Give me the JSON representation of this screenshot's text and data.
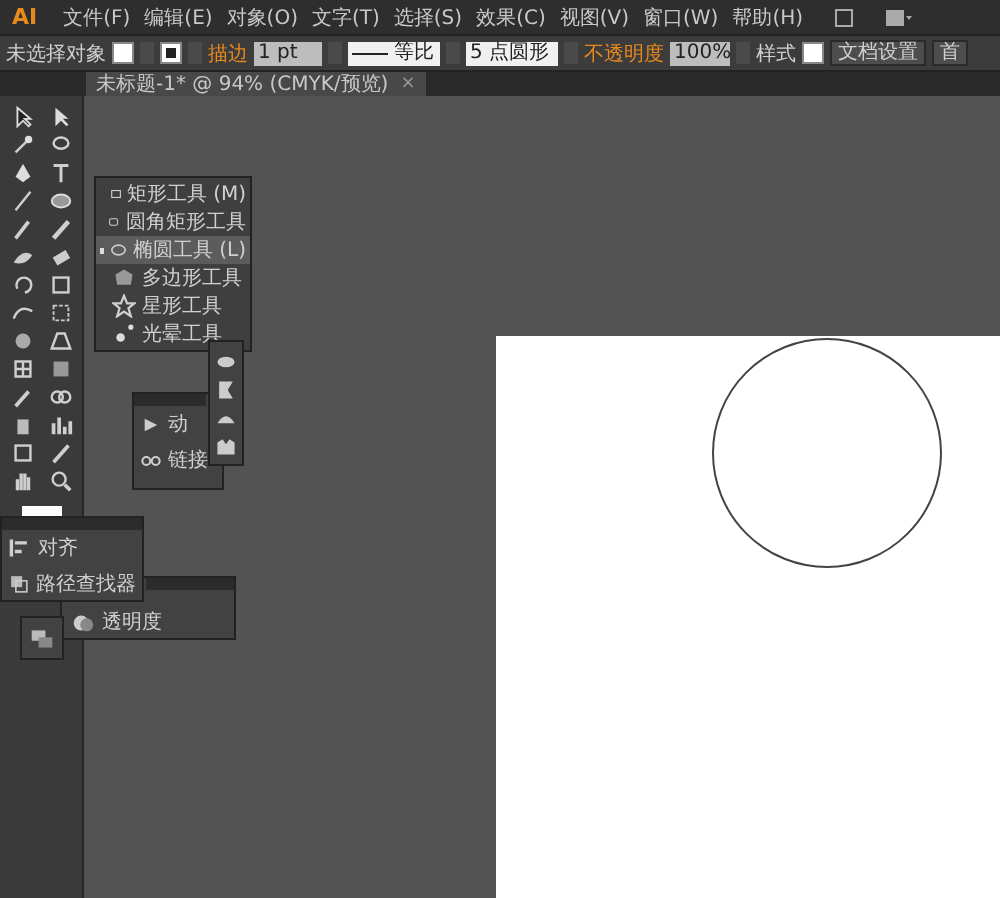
{
  "menu_bar": {
    "logo": "AI",
    "items": [
      "文件(F)",
      "编辑(E)",
      "对象(O)",
      "文字(T)",
      "选择(S)",
      "效果(C)",
      "视图(V)",
      "窗口(W)",
      "帮助(H)"
    ]
  },
  "control_bar": {
    "selection": "未选择对象",
    "stroke_label": "描边",
    "stroke_weight": "1 pt",
    "stroke_profile": "等比",
    "brush": "5 点圆形",
    "opacity_label": "不透明度",
    "opacity": "100%",
    "style_label": "样式",
    "buttons": [
      "文档设置",
      "首"
    ]
  },
  "document_tab": {
    "title": "未标题-1* @ 94% (CMYK/预览)",
    "close": "×"
  },
  "tool_flyout": {
    "items": [
      {
        "kind": "rect",
        "label": "矩形工具",
        "shortcut": "(M)",
        "selected": false
      },
      {
        "kind": "rounded",
        "label": "圆角矩形工具",
        "selected": false
      },
      {
        "kind": "ellipse",
        "label": "椭圆工具",
        "shortcut": "(L)",
        "selected": true
      },
      {
        "kind": "polygon",
        "label": "多边形工具",
        "selected": false
      },
      {
        "kind": "star",
        "label": "星形工具",
        "selected": false
      },
      {
        "kind": "flare",
        "label": "光晕工具",
        "selected": false
      }
    ]
  },
  "panels": {
    "actions_links": [
      "动",
      "链接"
    ],
    "align_pathfinder": [
      "对齐",
      "路径查找器"
    ],
    "transparency": [
      "透明度"
    ]
  }
}
